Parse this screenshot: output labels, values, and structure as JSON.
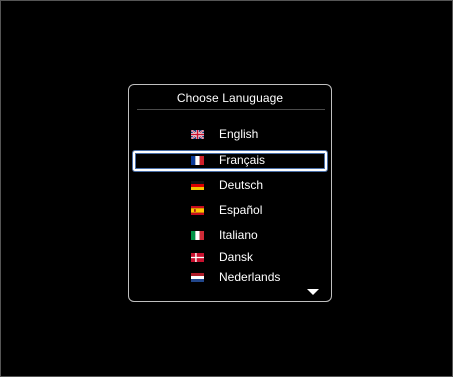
{
  "dialog": {
    "title": "Choose Lanuguage",
    "languages": [
      {
        "label": "English",
        "flag": "uk-flag-icon",
        "selected": false
      },
      {
        "label": "Français",
        "flag": "france-flag-icon",
        "selected": true
      },
      {
        "label": "Deutsch",
        "flag": "germany-flag-icon",
        "selected": false
      },
      {
        "label": "Español",
        "flag": "spain-flag-icon",
        "selected": false
      },
      {
        "label": "Italiano",
        "flag": "italy-flag-icon",
        "selected": false
      },
      {
        "label": "Dansk",
        "flag": "denmark-flag-icon",
        "selected": false
      },
      {
        "label": "Nederlands",
        "flag": "netherlands-flag-icon",
        "selected": false
      }
    ],
    "scroll_indicator": "chevron-down-icon"
  },
  "colors": {
    "background": "#000000",
    "border": "#bfbfbf",
    "selection_glow": "#4a6fa8",
    "text": "#ffffff"
  }
}
